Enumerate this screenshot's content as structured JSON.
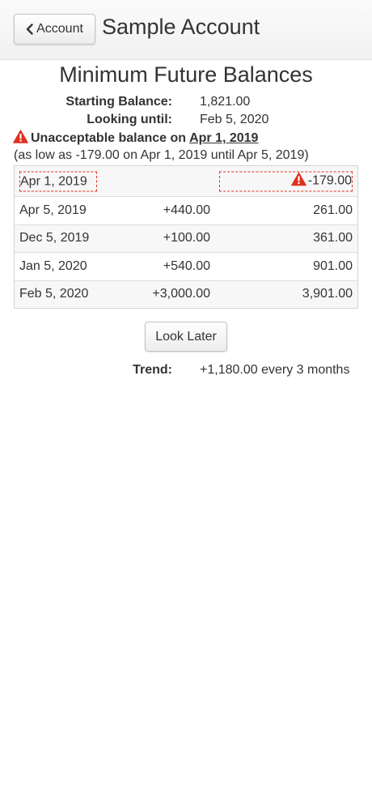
{
  "header": {
    "back_label": "Account",
    "title": "Sample Account"
  },
  "page_title": "Minimum Future Balances",
  "summary": {
    "starting_balance_label": "Starting Balance:",
    "starting_balance_value": "1,821.00",
    "looking_until_label": "Looking until:",
    "looking_until_value": "Feb 5, 2020"
  },
  "warning": {
    "text": "Unacceptable balance on",
    "date": "Apr 1, 2019",
    "detail": "(as low as -179.00 on Apr 1, 2019 until Apr 5, 2019)",
    "color": "#e0301e"
  },
  "rows": [
    {
      "date": "Apr 1, 2019",
      "delta": "",
      "balance": "-179.00"
    },
    {
      "date": "Apr 5, 2019",
      "delta": "+440.00",
      "balance": "261.00"
    },
    {
      "date": "Dec 5, 2019",
      "delta": "+100.00",
      "balance": "361.00"
    },
    {
      "date": "Jan 5, 2020",
      "delta": "+540.00",
      "balance": "901.00"
    },
    {
      "date": "Feb 5, 2020",
      "delta": "+3,000.00",
      "balance": "3,901.00"
    }
  ],
  "look_later_label": "Look Later",
  "trend": {
    "label": "Trend:",
    "value": "+1,180.00 every 3 months"
  }
}
